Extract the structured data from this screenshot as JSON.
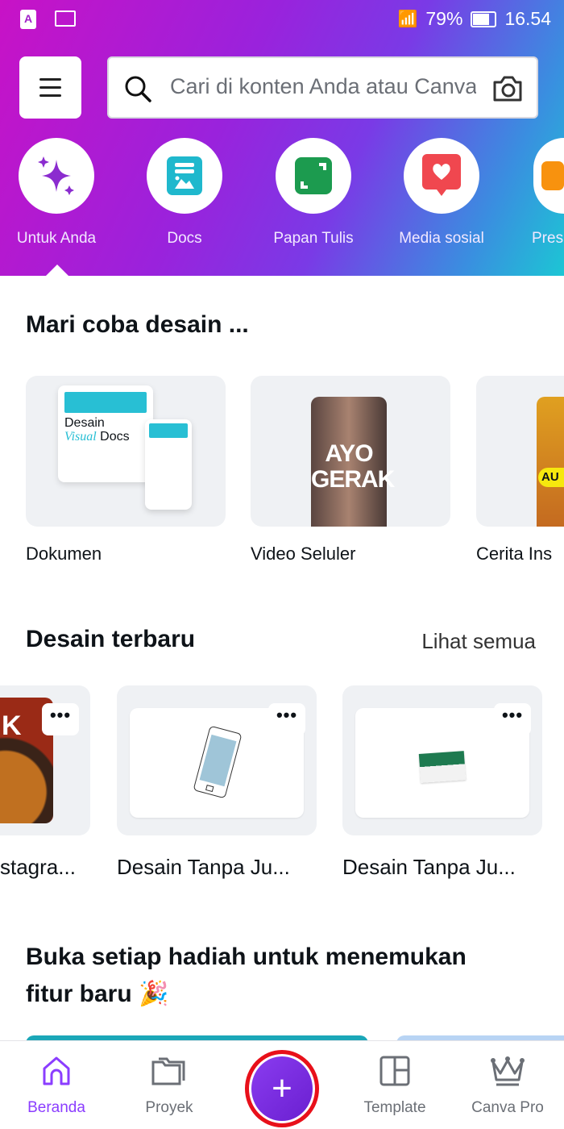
{
  "status_bar": {
    "battery": "79%",
    "battery_level": 0.79,
    "time": "16.54",
    "app_icon": "A"
  },
  "search": {
    "placeholder": "Cari di konten Anda atau Canva"
  },
  "categories": [
    {
      "label": "Untuk Anda",
      "icon": "sparkle-icon",
      "selected": true
    },
    {
      "label": "Docs",
      "icon": "docs-icon"
    },
    {
      "label": "Papan Tulis",
      "icon": "whiteboard-icon"
    },
    {
      "label": "Media sosial",
      "icon": "heart-bubble-icon"
    },
    {
      "label": "Pres",
      "icon": "presentation-icon"
    }
  ],
  "try_design": {
    "title": "Mari coba desain ...",
    "items": [
      {
        "label": "Dokumen",
        "thumb": {
          "line1": "Desain",
          "line2": "Visual",
          "line3": "Docs"
        }
      },
      {
        "label": "Video Seluler",
        "thumb": {
          "line1": "AYO",
          "line2": "GERAK"
        }
      },
      {
        "label": "Cerita Ins",
        "thumb": {
          "text": "AU"
        }
      }
    ]
  },
  "recent": {
    "title": "Desain terbaru",
    "see_all": "Lihat semua",
    "more": "•••",
    "items": [
      {
        "label": "stagra...",
        "thumb_text": "K"
      },
      {
        "label": "Desain Tanpa Ju..."
      },
      {
        "label": "Desain Tanpa Ju..."
      }
    ]
  },
  "gifts": {
    "title_line1": "Buka setiap hadiah untuk menemukan",
    "title_line2": "fitur baru 🎉"
  },
  "nav": {
    "items": [
      {
        "label": "Beranda",
        "active": true
      },
      {
        "label": "Proyek"
      },
      {
        "label": "Template"
      },
      {
        "label": "Canva Pro"
      }
    ],
    "fab": "+"
  },
  "colors": {
    "accent": "#8b3dff",
    "fab_ring": "#e8101a"
  }
}
